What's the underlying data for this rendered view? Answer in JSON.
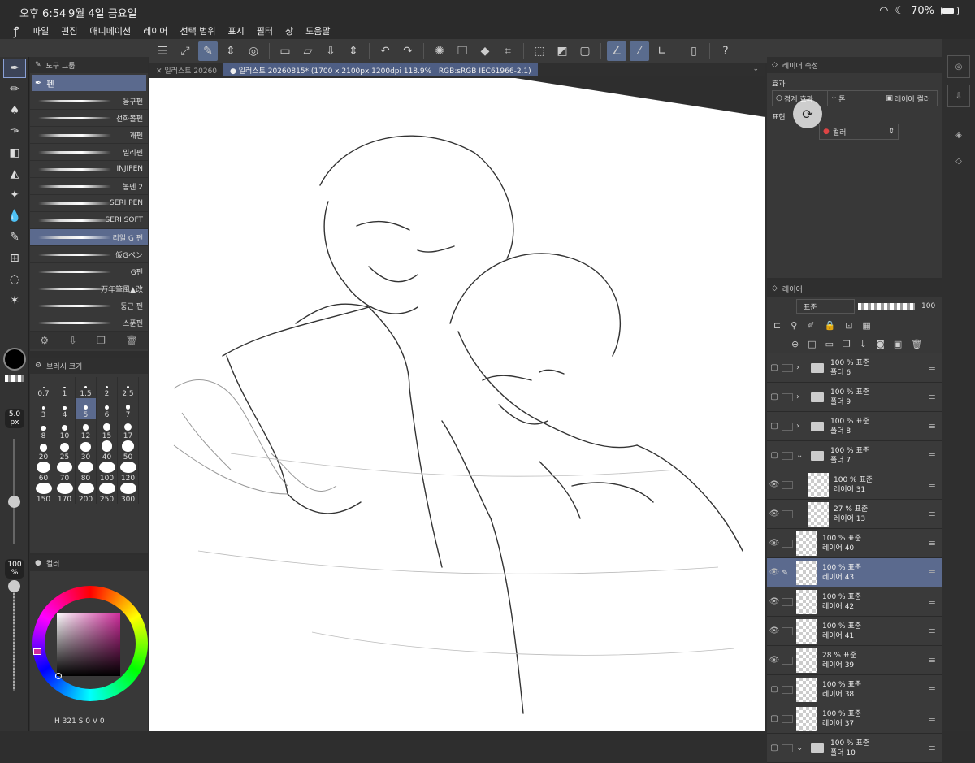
{
  "status": {
    "time": "오후 6:54",
    "date": "9월 4일 금요일",
    "battery": "70%"
  },
  "menu": [
    "파일",
    "편집",
    "애니메이션",
    "레이어",
    "선택 범위",
    "표시",
    "필터",
    "창",
    "도움말"
  ],
  "subtool": {
    "header": "도구 그룹",
    "group": "펜",
    "brushes": [
      "융구펜",
      "선화볼펜",
      "괘펜",
      "밀리펜",
      "INJIPEN",
      "농펜 2",
      "SERI PEN",
      "SERI SOFT",
      "리얼 G 펜",
      "仮Gペン",
      "G펜",
      "万年筆風▲改",
      "둥근 펜",
      "스푼펜"
    ],
    "active_brush_index": 8
  },
  "brushsize": {
    "header": "브러시 크기",
    "sizes": [
      "0.7",
      "1",
      "1.5",
      "2",
      "2.5",
      "3",
      "4",
      "5",
      "6",
      "7",
      "8",
      "10",
      "12",
      "15",
      "17",
      "20",
      "25",
      "30",
      "40",
      "50",
      "60",
      "70",
      "80",
      "100",
      "120",
      "150",
      "170",
      "200",
      "250",
      "300"
    ],
    "active_index": 7,
    "current": "5.0",
    "unit": "px"
  },
  "opacity": {
    "value": "100",
    "unit": "%"
  },
  "color": {
    "tab": "컬러",
    "status": "H 321 S 0 V 0",
    "main_color": "#000000",
    "hue_color": "#d02c9c"
  },
  "canvas": {
    "tabs": [
      "일러스트 20260",
      "일러스트 20260815* (1700 x 2100px 1200dpi 118.9% : RGB:sRGB IEC61966-2.1)"
    ]
  },
  "layerprops": {
    "title": "레이어 속성",
    "effect_label": "효과",
    "effects": [
      "경계 효과",
      "톤",
      "레이어 컬러"
    ],
    "expression_label": "표현",
    "expression_value": "컬러"
  },
  "layerpanel": {
    "title": "레이어",
    "blend_mode": "표준",
    "opacity": "100",
    "layers": [
      {
        "name": "폴더 6",
        "info": "100 % 표준",
        "type": "folder",
        "visible": false,
        "active": false
      },
      {
        "name": "폴더 9",
        "info": "100 % 표준",
        "type": "folder",
        "visible": false,
        "active": false
      },
      {
        "name": "폴더 8",
        "info": "100 % 표준",
        "type": "folder",
        "visible": false,
        "active": false
      },
      {
        "name": "폴더 7",
        "info": "100 % 표준",
        "type": "folder-open",
        "visible": false,
        "active": false
      },
      {
        "name": "레이어 31",
        "info": "100 % 표준",
        "type": "layer-indent",
        "visible": true,
        "active": false
      },
      {
        "name": "레이어 13",
        "info": "27 % 표준",
        "type": "layer-indent",
        "visible": true,
        "active": false
      },
      {
        "name": "레이어 40",
        "info": "100 % 표준",
        "type": "layer",
        "visible": true,
        "active": false
      },
      {
        "name": "레이어 43",
        "info": "100 % 표준",
        "type": "layer",
        "visible": true,
        "active": true
      },
      {
        "name": "레이어 42",
        "info": "100 % 표준",
        "type": "layer",
        "visible": true,
        "active": false
      },
      {
        "name": "레이어 41",
        "info": "100 % 표준",
        "type": "layer",
        "visible": true,
        "active": false
      },
      {
        "name": "레이어 39",
        "info": "28 % 표준",
        "type": "layer",
        "visible": true,
        "active": false
      },
      {
        "name": "레이어 38",
        "info": "100 % 표준",
        "type": "layer",
        "visible": false,
        "active": false
      },
      {
        "name": "레이어 37",
        "info": "100 % 표준",
        "type": "layer",
        "visible": false,
        "active": false
      },
      {
        "name": "폴더 10",
        "info": "100 % 표준",
        "type": "folder-open",
        "visible": false,
        "active": false
      }
    ]
  }
}
